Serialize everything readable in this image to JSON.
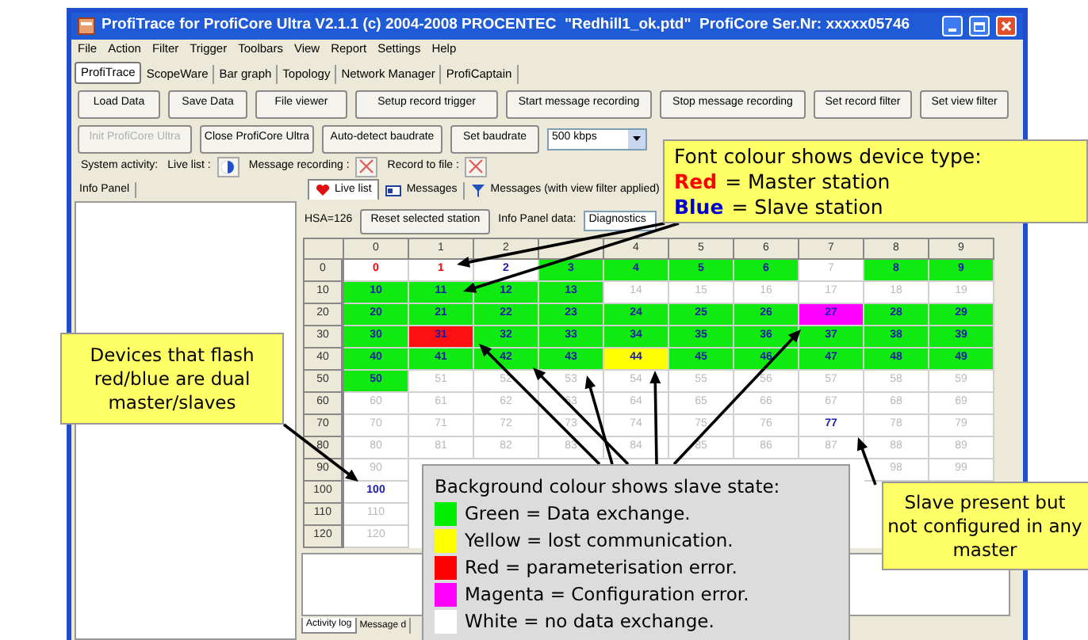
{
  "window": {
    "title": "ProfiTrace for ProfiCore Ultra V2.1.1 (c) 2004-2008 PROCENTEC  \"Redhill1_ok.ptd\"  ProfiCore Ser.Nr: xxxxx05746"
  },
  "menu": [
    "File",
    "Action",
    "Filter",
    "Trigger",
    "Toolbars",
    "View",
    "Report",
    "Settings",
    "Help"
  ],
  "main_tabs": [
    {
      "label": "ProfiTrace",
      "selected": true
    },
    {
      "label": "ScopeWare",
      "selected": false
    },
    {
      "label": "Bar graph",
      "selected": false
    },
    {
      "label": "Topology",
      "selected": false
    },
    {
      "label": "Network Manager",
      "selected": false
    },
    {
      "label": "ProfiCaptain",
      "selected": false
    }
  ],
  "toolbar_1": [
    "Load Data",
    "Save Data",
    "File viewer",
    "Setup record trigger",
    "Start message recording",
    "Stop message recording",
    "Set record filter",
    "Set view filter"
  ],
  "toolbar_2": {
    "buttons": [
      {
        "label": "Init ProfiCore Ultra",
        "disabled": true
      },
      {
        "label": "Close ProfiCore Ultra",
        "disabled": false
      },
      {
        "label": "Auto-detect baudrate",
        "disabled": false
      },
      {
        "label": "Set baudrate",
        "disabled": false
      }
    ],
    "baudrate": "500 kbps"
  },
  "system_activity": {
    "label": "System activity:",
    "items": [
      {
        "label": "Live list :",
        "kind": "running"
      },
      {
        "label": "Message recording :",
        "kind": "stopped"
      },
      {
        "label": "Record to file :",
        "kind": "stopped"
      }
    ]
  },
  "info_panel": {
    "tab": "Info Panel"
  },
  "view_tabs": [
    {
      "label": "Live list",
      "selected": true,
      "kind": "heart"
    },
    {
      "label": "Messages",
      "selected": false,
      "kind": "card"
    },
    {
      "label": "Messages (with view filter applied)",
      "selected": false,
      "kind": "filter"
    }
  ],
  "live_list": {
    "hsa": "HSA=126",
    "reset_button": "Reset selected station",
    "info_label": "Info Panel data:",
    "info_value": "Diagnostics",
    "columns": [
      "0",
      "1",
      "2",
      null,
      "4",
      "5",
      "6",
      "7",
      "8",
      "9"
    ],
    "rows": [
      {
        "label": "0",
        "cells": [
          {
            "text": "0",
            "kind": "master",
            "color": "#ffffff"
          },
          {
            "text": "1",
            "kind": "master",
            "color": "#ffffff"
          },
          {
            "text": "2",
            "kind": "slave",
            "color": "#ffffff"
          },
          {
            "text": "3",
            "kind": "slave",
            "color": "#11ea11"
          },
          {
            "text": "4",
            "kind": "slave",
            "color": "#11ea11"
          },
          {
            "text": "5",
            "kind": "slave",
            "color": "#11ea11"
          },
          {
            "text": "6",
            "kind": "slave",
            "color": "#11ea11"
          },
          {
            "text": "7",
            "kind": "absent",
            "color": "#ffffff"
          },
          {
            "text": "8",
            "kind": "slave",
            "color": "#11ea11"
          },
          {
            "text": "9",
            "kind": "slave",
            "color": "#11ea11"
          }
        ]
      },
      {
        "label": "10",
        "cells": [
          {
            "text": "10",
            "kind": "slave",
            "color": "#11ea11"
          },
          {
            "text": "11",
            "kind": "slave",
            "color": "#11ea11"
          },
          {
            "text": "12",
            "kind": "slave",
            "color": "#11ea11"
          },
          {
            "text": "13",
            "kind": "slave",
            "color": "#11ea11"
          },
          {
            "text": "14",
            "kind": "absent",
            "color": "#ffffff"
          },
          {
            "text": "15",
            "kind": "absent",
            "color": "#ffffff"
          },
          {
            "text": "16",
            "kind": "absent",
            "color": "#ffffff"
          },
          {
            "text": "17",
            "kind": "absent",
            "color": "#ffffff"
          },
          {
            "text": "18",
            "kind": "absent",
            "color": "#ffffff"
          },
          {
            "text": "19",
            "kind": "absent",
            "color": "#ffffff"
          }
        ]
      },
      {
        "label": "20",
        "cells": [
          {
            "text": "20",
            "kind": "slave",
            "color": "#11ea11"
          },
          {
            "text": "21",
            "kind": "slave",
            "color": "#11ea11"
          },
          {
            "text": "22",
            "kind": "slave",
            "color": "#11ea11"
          },
          {
            "text": "23",
            "kind": "slave",
            "color": "#11ea11"
          },
          {
            "text": "24",
            "kind": "slave",
            "color": "#11ea11"
          },
          {
            "text": "25",
            "kind": "slave",
            "color": "#11ea11"
          },
          {
            "text": "26",
            "kind": "slave",
            "color": "#11ea11"
          },
          {
            "text": "27",
            "kind": "slave",
            "color": "#ff00ff"
          },
          {
            "text": "28",
            "kind": "slave",
            "color": "#11ea11"
          },
          {
            "text": "29",
            "kind": "slave",
            "color": "#11ea11"
          }
        ]
      },
      {
        "label": "30",
        "cells": [
          {
            "text": "30",
            "kind": "slave",
            "color": "#11ea11"
          },
          {
            "text": "31",
            "kind": "slave",
            "color": "#ff1010"
          },
          {
            "text": "32",
            "kind": "slave",
            "color": "#11ea11"
          },
          {
            "text": "33",
            "kind": "slave",
            "color": "#11ea11"
          },
          {
            "text": "34",
            "kind": "slave",
            "color": "#11ea11"
          },
          {
            "text": "35",
            "kind": "slave",
            "color": "#11ea11"
          },
          {
            "text": "36",
            "kind": "slave",
            "color": "#11ea11"
          },
          {
            "text": "37",
            "kind": "slave",
            "color": "#11ea11"
          },
          {
            "text": "38",
            "kind": "slave",
            "color": "#11ea11"
          },
          {
            "text": "39",
            "kind": "slave",
            "color": "#11ea11"
          }
        ]
      },
      {
        "label": "40",
        "cells": [
          {
            "text": "40",
            "kind": "slave",
            "color": "#11ea11"
          },
          {
            "text": "41",
            "kind": "slave",
            "color": "#11ea11"
          },
          {
            "text": "42",
            "kind": "slave",
            "color": "#11ea11"
          },
          {
            "text": "43",
            "kind": "slave",
            "color": "#11ea11"
          },
          {
            "text": "44",
            "kind": "slave",
            "color": "#ffff00"
          },
          {
            "text": "45",
            "kind": "slave",
            "color": "#11ea11"
          },
          {
            "text": "46",
            "kind": "slave",
            "color": "#11ea11"
          },
          {
            "text": "47",
            "kind": "slave",
            "color": "#11ea11"
          },
          {
            "text": "48",
            "kind": "slave",
            "color": "#11ea11"
          },
          {
            "text": "49",
            "kind": "slave",
            "color": "#11ea11"
          }
        ]
      },
      {
        "label": "50",
        "cells": [
          {
            "text": "50",
            "kind": "slave",
            "color": "#11ea11"
          },
          {
            "text": "51",
            "kind": "absent",
            "color": "#ffffff"
          },
          {
            "text": "52",
            "kind": "absent",
            "color": "#ffffff"
          },
          {
            "text": "53",
            "kind": "absent",
            "color": "#ffffff"
          },
          {
            "text": "54",
            "kind": "absent",
            "color": "#ffffff"
          },
          {
            "text": "55",
            "kind": "absent",
            "color": "#ffffff"
          },
          {
            "text": "56",
            "kind": "absent",
            "color": "#ffffff"
          },
          {
            "text": "57",
            "kind": "absent",
            "color": "#ffffff"
          },
          {
            "text": "58",
            "kind": "absent",
            "color": "#ffffff"
          },
          {
            "text": "59",
            "kind": "absent",
            "color": "#ffffff"
          }
        ]
      },
      {
        "label": "60",
        "cells": [
          {
            "text": "60",
            "kind": "absent",
            "color": "#ffffff"
          },
          {
            "text": "61",
            "kind": "absent",
            "color": "#ffffff"
          },
          {
            "text": "62",
            "kind": "absent",
            "color": "#ffffff"
          },
          {
            "text": "63",
            "kind": "absent",
            "color": "#ffffff"
          },
          {
            "text": "64",
            "kind": "absent",
            "color": "#ffffff"
          },
          {
            "text": "65",
            "kind": "absent",
            "color": "#ffffff"
          },
          {
            "text": "66",
            "kind": "absent",
            "color": "#ffffff"
          },
          {
            "text": "67",
            "kind": "absent",
            "color": "#ffffff"
          },
          {
            "text": "68",
            "kind": "absent",
            "color": "#ffffff"
          },
          {
            "text": "69",
            "kind": "absent",
            "color": "#ffffff"
          }
        ]
      },
      {
        "label": "70",
        "cells": [
          {
            "text": "70",
            "kind": "absent",
            "color": "#ffffff"
          },
          {
            "text": "71",
            "kind": "absent",
            "color": "#ffffff"
          },
          {
            "text": "72",
            "kind": "absent",
            "color": "#ffffff"
          },
          {
            "text": "73",
            "kind": "absent",
            "color": "#ffffff"
          },
          {
            "text": "74",
            "kind": "absent",
            "color": "#ffffff"
          },
          {
            "text": "75",
            "kind": "absent",
            "color": "#ffffff"
          },
          {
            "text": "76",
            "kind": "absent",
            "color": "#ffffff"
          },
          {
            "text": "77",
            "kind": "slave",
            "color": "#ffffff"
          },
          {
            "text": "78",
            "kind": "absent",
            "color": "#ffffff"
          },
          {
            "text": "79",
            "kind": "absent",
            "color": "#ffffff"
          }
        ]
      },
      {
        "label": "80",
        "cells": [
          {
            "text": "80",
            "kind": "absent",
            "color": "#ffffff"
          },
          {
            "text": "81",
            "kind": "absent",
            "color": "#ffffff"
          },
          {
            "text": "82",
            "kind": "absent",
            "color": "#ffffff"
          },
          {
            "text": "83",
            "kind": "absent",
            "color": "#ffffff"
          },
          {
            "text": "84",
            "kind": "absent",
            "color": "#ffffff"
          },
          {
            "text": "85",
            "kind": "absent",
            "color": "#ffffff"
          },
          {
            "text": "86",
            "kind": "absent",
            "color": "#ffffff"
          },
          {
            "text": "87",
            "kind": "absent",
            "color": "#ffffff"
          },
          {
            "text": "88",
            "kind": "absent",
            "color": "#ffffff"
          },
          {
            "text": "89",
            "kind": "absent",
            "color": "#ffffff"
          }
        ]
      },
      {
        "label": "90",
        "cells": [
          {
            "text": "90",
            "kind": "absent",
            "color": "#ffffff"
          },
          null,
          null,
          null,
          null,
          null,
          null,
          null,
          {
            "text": "98",
            "kind": "absent",
            "color": "#ffffff"
          },
          {
            "text": "99",
            "kind": "absent",
            "color": "#ffffff"
          }
        ]
      },
      {
        "label": "100",
        "cells": [
          {
            "text": "100",
            "kind": "slave",
            "color": "#ffffff"
          },
          null,
          null,
          null,
          null,
          null,
          null,
          null,
          null,
          null
        ]
      },
      {
        "label": "110",
        "cells": [
          {
            "text": "110",
            "kind": "absent",
            "color": "#ffffff"
          },
          null,
          null,
          null,
          null,
          null,
          null,
          null,
          null,
          null
        ]
      },
      {
        "label": "120",
        "cells": [
          {
            "text": "120",
            "kind": "absent",
            "color": "#ffffff"
          },
          null,
          null,
          null,
          null,
          null,
          null,
          null,
          null,
          null
        ]
      }
    ]
  },
  "bottom_tabs": [
    {
      "label": "Activity log",
      "selected": true
    },
    {
      "label": "Message d",
      "selected": false
    }
  ],
  "font_legend": {
    "title": "Font colour shows device type:",
    "items": [
      {
        "term": "Red",
        "text": "= Master station",
        "color": "#ff0000"
      },
      {
        "term": "Blue",
        "text": "= Slave station",
        "color": "#0000cc"
      }
    ]
  },
  "dual_note": {
    "text": "Devices that flash red/blue are dual master/slaves"
  },
  "state_legend": {
    "title": "Background colour shows slave state:",
    "items": [
      {
        "text": "Green = Data exchange.",
        "color": "#00ee00"
      },
      {
        "text": "Yellow = lost communication.",
        "color": "#ffff00"
      },
      {
        "text": "Red = parameterisation error.",
        "color": "#ff0000"
      },
      {
        "text": "Magenta = Configuration error.",
        "color": "#ff00ff"
      },
      {
        "text": "White = no data exchange.",
        "color": "#ffffff"
      }
    ]
  },
  "unconfigured_note": {
    "text": "Slave present but not configured in any master"
  }
}
